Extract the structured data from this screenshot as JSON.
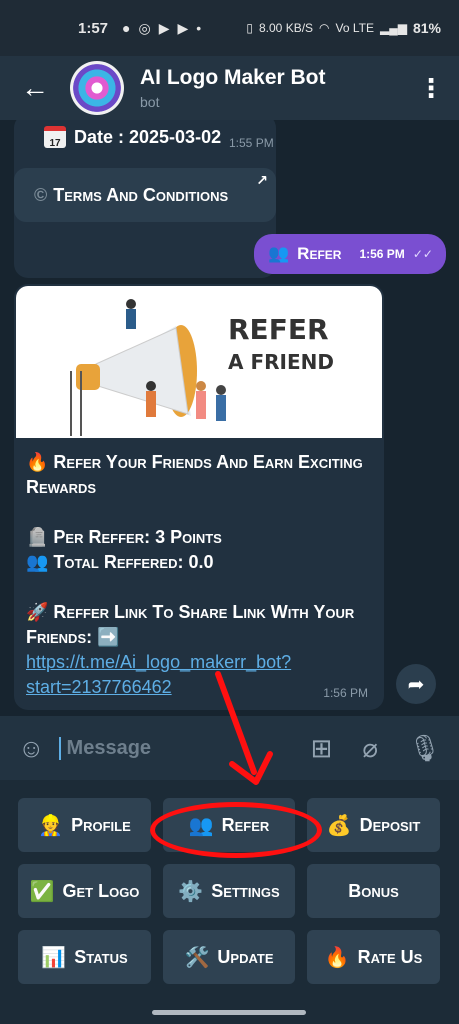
{
  "status_bar": {
    "time": "1:57",
    "net_speed": "8.00 KB/S",
    "network": "Vo LTE",
    "battery": "81%"
  },
  "header": {
    "title": "AI Logo Maker Bot",
    "subtitle": "bot"
  },
  "chat": {
    "old_message": {
      "date_line": "Date : 2025-03-02",
      "time": "1:55 PM"
    },
    "terms_button": "Terms And Conditions",
    "outgoing": {
      "emoji": "👥",
      "text": "Refer",
      "time": "1:56 PM"
    },
    "card": {
      "image_text_line1": "REFER",
      "image_text_line2": "A FRIEND",
      "headline": "🔥 Refer Your Friends And Earn Exciting Rewards",
      "per_refer": "🪦 Per Reffer: 3 Points",
      "total_referred": "👥 Total Reffered: 0.0",
      "share_text": "🚀 Reffer Link To Share Link With Your Friends: ➡️",
      "link": "https://t.me/Ai_logo_makerr_bot?start=2137766462",
      "time": "1:56 PM"
    }
  },
  "composer": {
    "placeholder": "Message"
  },
  "keyboard": [
    {
      "icon": "👷",
      "label": "Profile"
    },
    {
      "icon": "👥",
      "label": "Refer"
    },
    {
      "icon": "💰",
      "label": "Deposit"
    },
    {
      "icon": "✅",
      "label": "Get Logo"
    },
    {
      "icon": "⚙️",
      "label": "Settings"
    },
    {
      "icon": "",
      "label": "Bonus"
    },
    {
      "icon": "📊",
      "label": "Status"
    },
    {
      "icon": "🛠️",
      "label": "Update"
    },
    {
      "icon": "🔥",
      "label": "Rate Us"
    }
  ],
  "colors": {
    "annotation": "#ff1010",
    "outgoing_bubble": "#7a4fd1",
    "link": "#5eaee5"
  }
}
